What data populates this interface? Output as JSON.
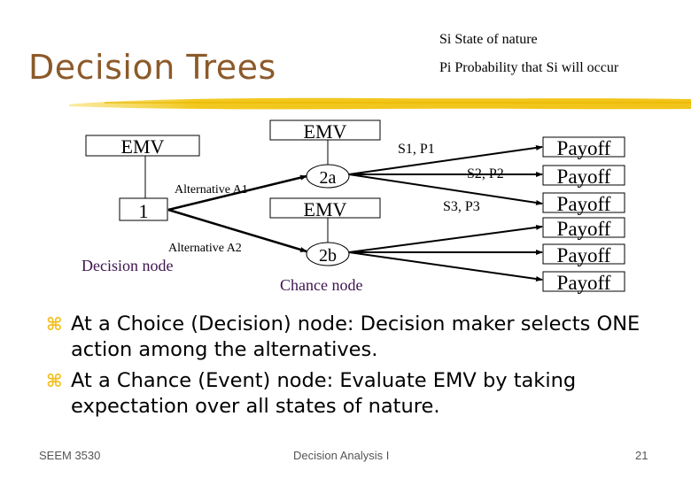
{
  "slide": {
    "title": "Decision Trees",
    "legend": {
      "si": "Si State of nature",
      "pi": "Pi Probability that Si will occur"
    },
    "colors": {
      "title": "#8c5a2a",
      "accent_brush": "#f2c81e",
      "bullet": "#f0c020",
      "node_caption": "#3d1450"
    }
  },
  "diagram": {
    "decision_emv": "EMV",
    "decision_node": "1",
    "decision_caption": "Decision node",
    "alternatives": [
      "Alternative A1",
      "Alternative A2"
    ],
    "chance_nodes": [
      {
        "label": "2a",
        "emv": "EMV"
      },
      {
        "label": "2b",
        "emv": "EMV"
      }
    ],
    "chance_caption": "Chance node",
    "states": [
      "S1, P1",
      "S2, P2",
      "S3, P3"
    ],
    "payoffs": [
      "Payoff",
      "Payoff",
      "Payoff",
      "Payoff",
      "Payoff",
      "Payoff"
    ]
  },
  "bullets": [
    {
      "icon": "z-bullet-icon",
      "text": "At a Choice (Decision) node: Decision maker selects ONE action among the alternatives."
    },
    {
      "icon": "z-bullet-icon",
      "text": "At a Chance (Event) node: Evaluate EMV by taking expectation over all states of nature."
    }
  ],
  "footer": {
    "course": "SEEM 3530",
    "topic": "Decision Analysis I",
    "page": "21"
  }
}
